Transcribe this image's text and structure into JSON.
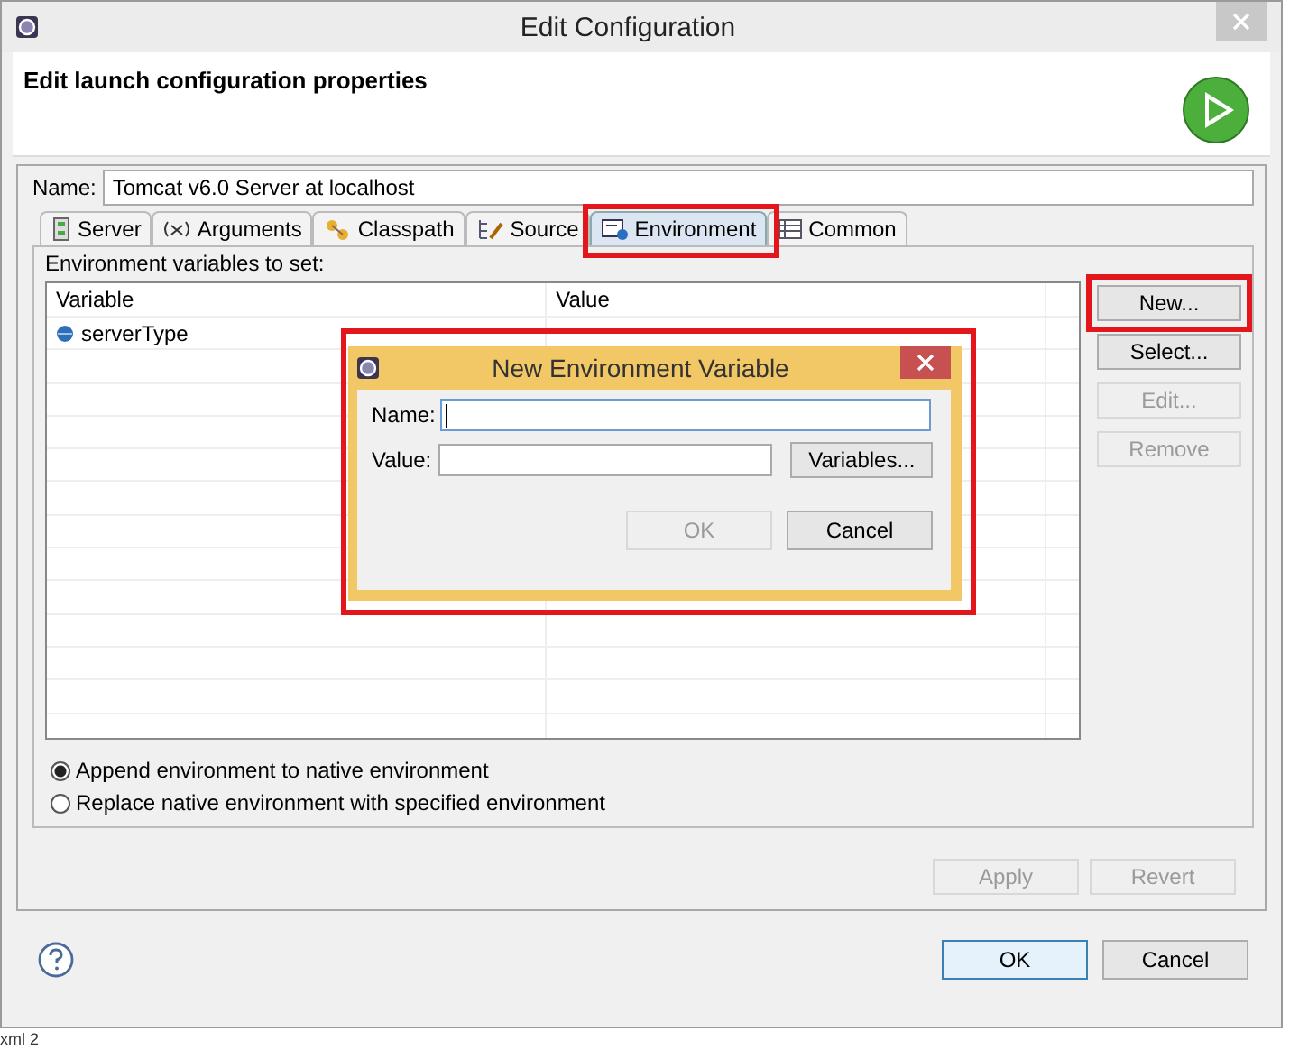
{
  "window": {
    "title": "Edit Configuration"
  },
  "header": {
    "title": "Edit launch configuration properties"
  },
  "name_field": {
    "label": "Name:",
    "value": "Tomcat v6.0 Server at localhost"
  },
  "tabs": [
    {
      "label": "Server",
      "selected": false,
      "highlighted": false
    },
    {
      "label": "Arguments",
      "selected": false,
      "highlighted": false
    },
    {
      "label": "Classpath",
      "selected": false,
      "highlighted": false
    },
    {
      "label": "Source",
      "selected": false,
      "highlighted": false
    },
    {
      "label": "Environment",
      "selected": true,
      "highlighted": true
    },
    {
      "label": "Common",
      "selected": false,
      "highlighted": false
    }
  ],
  "env_panel": {
    "label": "Environment variables to set:",
    "table": {
      "columns": [
        "Variable",
        "Value"
      ],
      "rows": [
        {
          "variable": "serverType"
        }
      ]
    },
    "buttons": [
      {
        "label": "New...",
        "disabled": false,
        "highlighted": true
      },
      {
        "label": "Select...",
        "disabled": false,
        "highlighted": false
      },
      {
        "label": "Edit...",
        "disabled": true,
        "highlighted": false
      },
      {
        "label": "Remove",
        "disabled": true,
        "highlighted": false
      }
    ],
    "radios": [
      {
        "label": "Append environment to native environment",
        "selected": true
      },
      {
        "label": "Replace native environment with specified environment",
        "selected": false
      }
    ]
  },
  "panel_buttons": [
    {
      "label": "Apply",
      "disabled": true
    },
    {
      "label": "Revert",
      "disabled": true
    }
  ],
  "footer_buttons": [
    {
      "label": "OK",
      "default": true
    },
    {
      "label": "Cancel",
      "default": false
    }
  ],
  "dialog": {
    "title": "New Environment Variable",
    "highlighted": true,
    "fields": [
      {
        "label": "Name:",
        "focused": true
      },
      {
        "label": "Value:",
        "focused": false
      }
    ],
    "variables_button": "Variables...",
    "buttons": [
      {
        "label": "OK",
        "disabled": true
      },
      {
        "label": "Cancel",
        "disabled": false
      }
    ]
  },
  "background_text": "xml 2"
}
